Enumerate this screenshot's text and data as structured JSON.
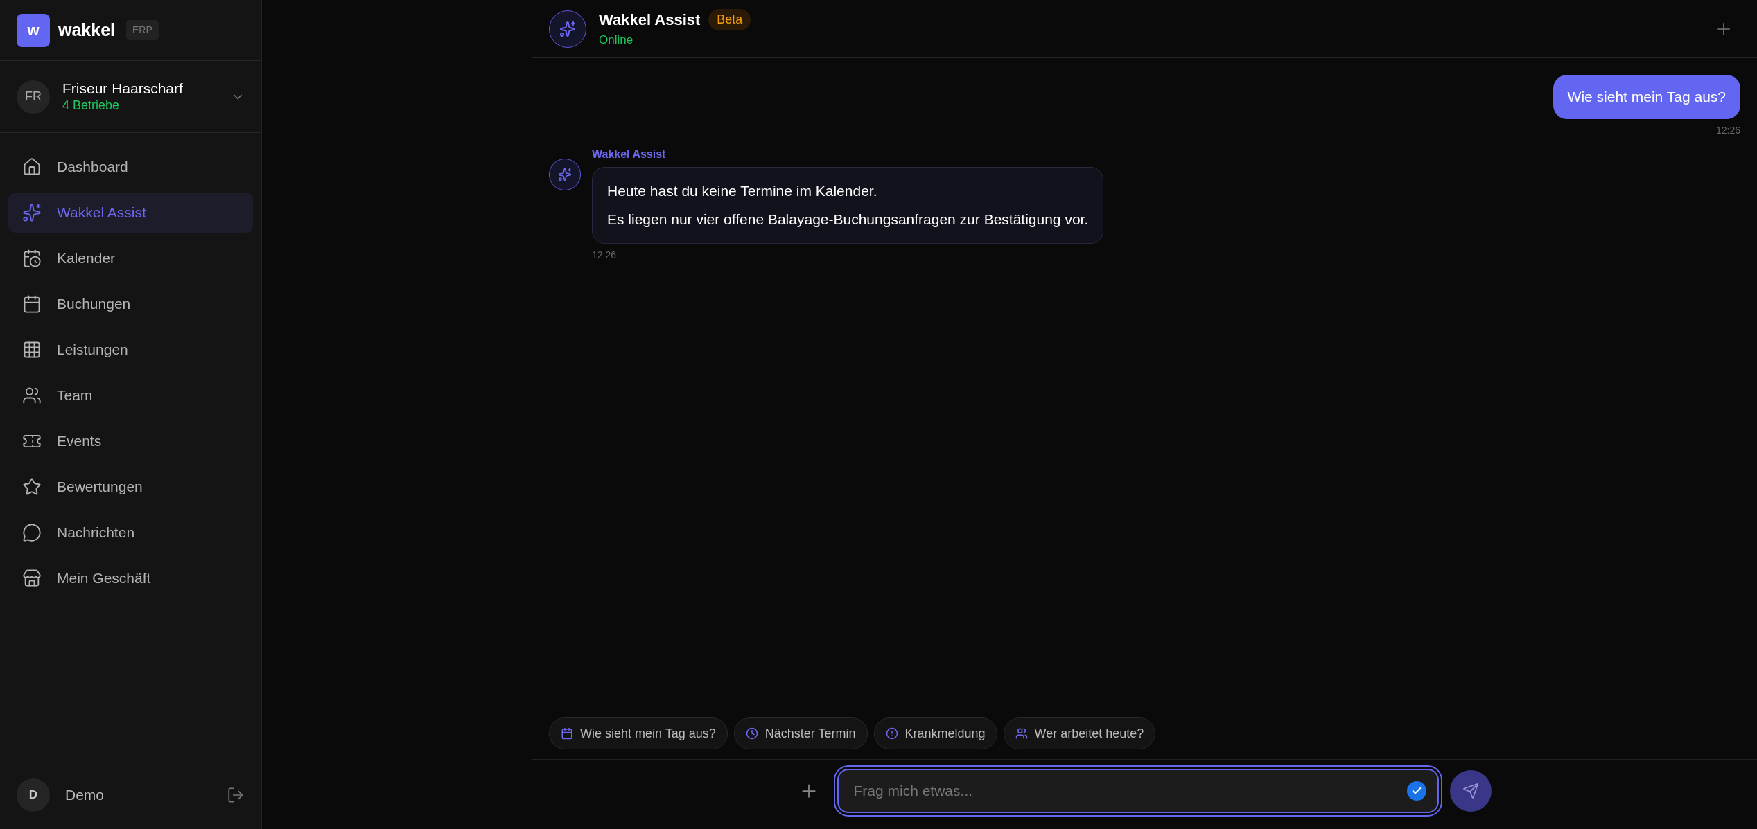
{
  "brand": {
    "logo_letter": "w",
    "name": "wakkel",
    "badge": "ERP"
  },
  "business": {
    "initials": "FR",
    "name": "Friseur Haarscharf",
    "subtitle": "4 Betriebe"
  },
  "nav": [
    {
      "label": "Dashboard",
      "selected": false
    },
    {
      "label": "Wakkel Assist",
      "selected": true
    },
    {
      "label": "Kalender",
      "selected": false
    },
    {
      "label": "Buchungen",
      "selected": false
    },
    {
      "label": "Leistungen",
      "selected": false
    },
    {
      "label": "Team",
      "selected": false
    },
    {
      "label": "Events",
      "selected": false
    },
    {
      "label": "Bewertungen",
      "selected": false
    },
    {
      "label": "Nachrichten",
      "selected": false
    },
    {
      "label": "Mein Geschäft",
      "selected": false
    }
  ],
  "user": {
    "initial": "D",
    "name": "Demo"
  },
  "chat_header": {
    "title": "Wakkel Assist",
    "badge": "Beta",
    "status": "Online"
  },
  "messages": [
    {
      "kind": "user",
      "lines": [
        "Wie sieht mein Tag aus?"
      ],
      "time": "12:26"
    },
    {
      "kind": "assistant",
      "sender": "Wakkel Assist",
      "lines": [
        "Heute hast du keine Termine im Kalender.",
        "Es liegen nur vier offene Balayage-Buchungsanfragen zur Bestätigung vor."
      ],
      "time": "12:26"
    }
  ],
  "suggestions": [
    "Wie sieht mein Tag aus?",
    "Nächster Termin",
    "Krankmeldung",
    "Wer arbeitet heute?"
  ],
  "composer": {
    "placeholder": "Frag mich etwas..."
  }
}
